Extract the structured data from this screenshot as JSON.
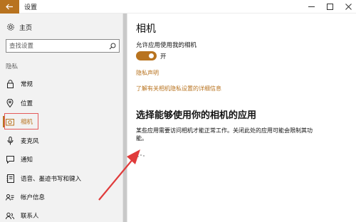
{
  "window": {
    "title": "设置",
    "icons": {
      "back": "arrow-left-icon",
      "minimize": "minimize-icon",
      "maximize": "maximize-icon",
      "close": "close-icon"
    }
  },
  "sidebar": {
    "home": {
      "label": "主页",
      "icon": "gear-icon"
    },
    "search": {
      "placeholder": "查找设置",
      "icon": "search-icon"
    },
    "section_label": "隐私",
    "items": [
      {
        "label": "常规",
        "icon": "lock-icon",
        "active": false
      },
      {
        "label": "位置",
        "icon": "location-pin-icon",
        "active": false
      },
      {
        "label": "相机",
        "icon": "camera-icon",
        "active": true
      },
      {
        "label": "麦克风",
        "icon": "microphone-icon",
        "active": false
      },
      {
        "label": "通知",
        "icon": "chat-bubble-icon",
        "active": false
      },
      {
        "label": "语音、墨迹书写和键入",
        "icon": "notebook-icon",
        "active": false
      },
      {
        "label": "帐户信息",
        "icon": "account-info-icon",
        "active": false
      },
      {
        "label": "联系人",
        "icon": "contacts-icon",
        "active": false
      }
    ]
  },
  "main": {
    "title": "相机",
    "allow_label": "允许应用使用我的相机",
    "toggle_state": "开",
    "toggle_on": true,
    "privacy_link": "隐私声明",
    "learn_more_link": "了解有关相机隐私设置的详细信息",
    "section_title": "选择能够使用你的相机的应用",
    "description": "某些应用需要访问相机才能正常工作。关闭此处的应用可能会限制其功能。"
  },
  "colors": {
    "accent": "#b8731f",
    "highlight_frame": "#e45a5a",
    "annotation_arrow": "#e03b3b",
    "sidebar_bg": "#f2f2f2"
  }
}
